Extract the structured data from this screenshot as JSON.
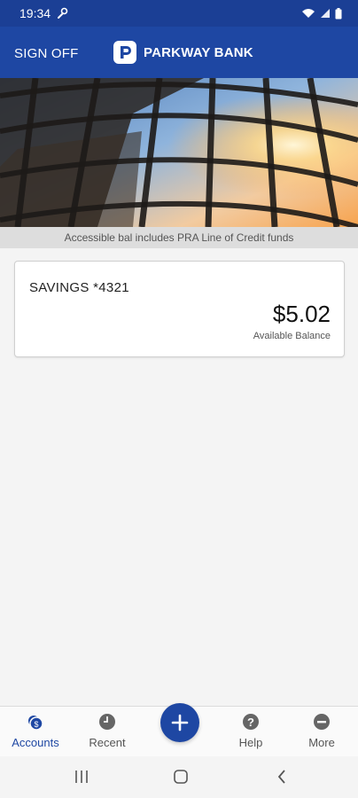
{
  "status_bar": {
    "time": "19:34"
  },
  "header": {
    "sign_off_label": "SIGN OFF",
    "brand_name": "PARKWAY BANK",
    "brand_color": "#1e47a3"
  },
  "notice": "Accessible bal includes PRA Line of Credit funds",
  "account": {
    "name": "SAVINGS *4321",
    "balance": "$5.02",
    "balance_label": "Available Balance"
  },
  "bottom_nav": {
    "items": [
      {
        "label": "Accounts",
        "icon": "accounts-icon",
        "active": true
      },
      {
        "label": "Recent",
        "icon": "clock-icon",
        "active": false
      },
      {
        "label": "Help",
        "icon": "help-icon",
        "active": false
      },
      {
        "label": "More",
        "icon": "more-icon",
        "active": false
      }
    ],
    "fab_icon": "plus-icon"
  },
  "system_nav": [
    "recent-apps-icon",
    "home-icon",
    "back-icon"
  ]
}
